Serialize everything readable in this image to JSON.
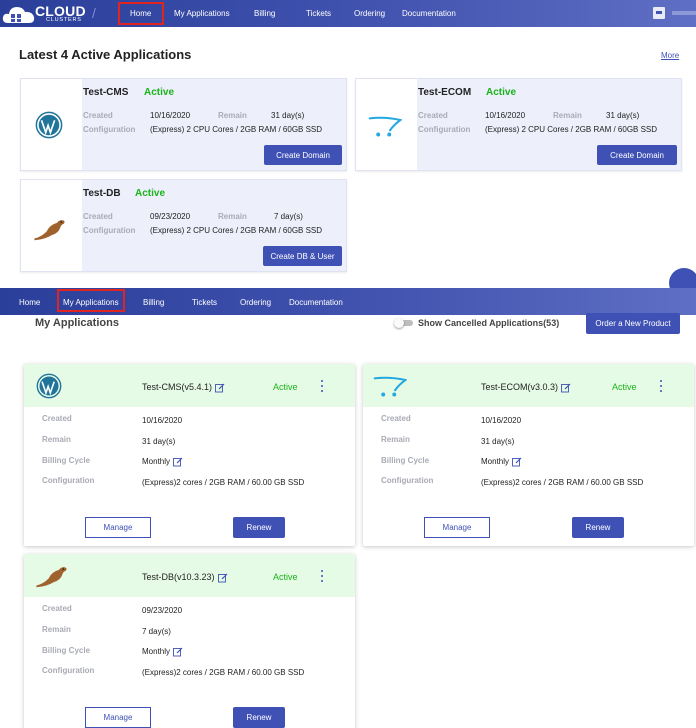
{
  "brand": {
    "name": "CLOUD",
    "sub": "CLUSTERS"
  },
  "nav_top": {
    "items": [
      "Home",
      "My Applications",
      "Billing",
      "Tickets",
      "Ordering",
      "Documentation"
    ],
    "highlighted": "Home"
  },
  "latest": {
    "title": "Latest 4 Active Applications",
    "more": "More",
    "cards": [
      {
        "name": "Test-CMS",
        "status": "Active",
        "created_label": "Created",
        "created": "10/16/2020",
        "remain_label": "Remain",
        "remain": "31 day(s)",
        "config_label": "Configuration",
        "config": "(Express) 2 CPU Cores / 2GB RAM / 60GB SSD",
        "action": "Create Domain",
        "icon": "wordpress-logo"
      },
      {
        "name": "Test-ECOM",
        "status": "Active",
        "created_label": "Created",
        "created": "10/16/2020",
        "remain_label": "Remain",
        "remain": "31 day(s)",
        "config_label": "Configuration",
        "config": "(Express) 2 CPU Cores / 2GB RAM / 60GB SSD",
        "action": "Create Domain",
        "icon": "opencart-logo"
      },
      {
        "name": "Test-DB",
        "status": "Active",
        "created_label": "Created",
        "created": "09/23/2020",
        "remain_label": "Remain",
        "remain": "7 day(s)",
        "config_label": "Configuration",
        "config": "(Express) 2 CPU Cores / 2GB RAM / 60GB SSD",
        "action": "Create DB & User",
        "icon": "mariadb-seal-logo"
      }
    ]
  },
  "nav_second": {
    "items": [
      "Home",
      "My Applications",
      "Billing",
      "Tickets",
      "Ordering",
      "Documentation"
    ],
    "highlighted": "My Applications"
  },
  "my_apps": {
    "title": "My Applications",
    "toggle_label": "Show Cancelled Applications(53)",
    "order_button": "Order a New Product",
    "labels": {
      "created": "Created",
      "remain": "Remain",
      "billing": "Billing Cycle",
      "config": "Configuration",
      "manage": "Manage",
      "renew": "Renew"
    },
    "cards": [
      {
        "name": "Test-CMS(v5.4.1)",
        "status": "Active",
        "created": "10/16/2020",
        "remain": "31 day(s)",
        "billing": "Monthly",
        "config": "(Express)2 cores / 2GB RAM / 60.00 GB SSD",
        "icon": "wordpress-logo"
      },
      {
        "name": "Test-ECOM(v3.0.3)",
        "status": "Active",
        "created": "10/16/2020",
        "remain": "31 day(s)",
        "billing": "Monthly",
        "config": "(Express)2 cores / 2GB RAM / 60.00 GB SSD",
        "icon": "opencart-logo"
      },
      {
        "name": "Test-DB(v10.3.23)",
        "status": "Active",
        "created": "09/23/2020",
        "remain": "7 day(s)",
        "billing": "Monthly",
        "config": "(Express)2 cores / 2GB RAM / 60.00 GB SSD",
        "icon": "mariadb-seal-logo"
      }
    ]
  },
  "colors": {
    "primary": "#3f51b5",
    "active_green": "#19b419",
    "highlight_red": "#e0241f",
    "card_bg": "#edeffb",
    "head_bg": "#e6fbe6"
  }
}
